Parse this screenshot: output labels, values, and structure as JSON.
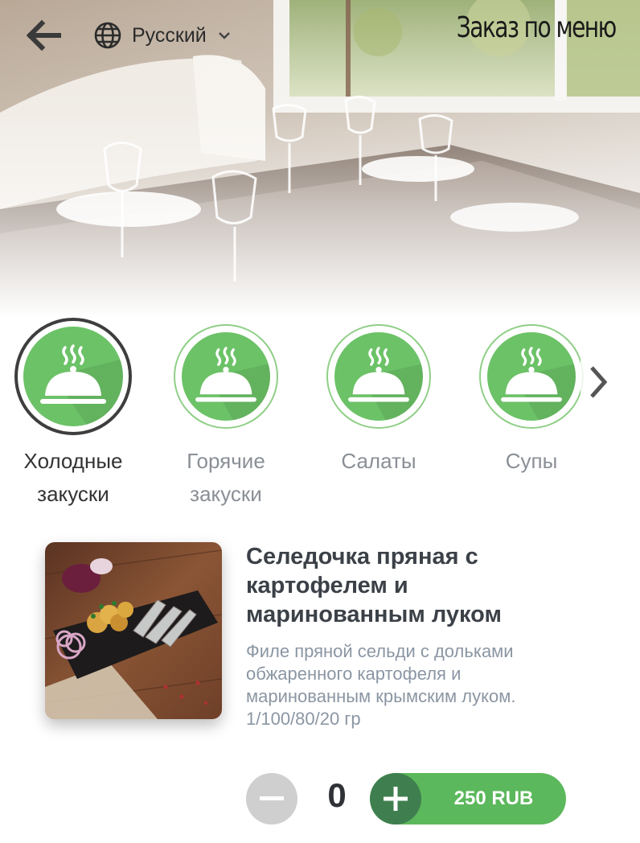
{
  "header": {
    "title": "Заказ по меню",
    "language": "Русский",
    "back_icon": "arrow-left-icon",
    "language_icon": "globe-icon"
  },
  "categories": {
    "items": [
      {
        "line1": "Холодные",
        "line2": "закуски",
        "active": true,
        "icon": "cloche-icon"
      },
      {
        "line1": "Горячие",
        "line2": "закуски",
        "active": false,
        "icon": "cloche-icon"
      },
      {
        "line1": "Салаты",
        "line2": "",
        "active": false,
        "icon": "cloche-icon"
      },
      {
        "line1": "Супы",
        "line2": "",
        "active": false,
        "icon": "cloche-icon"
      }
    ],
    "next_icon": "chevron-right-icon"
  },
  "item": {
    "title": "Селедочка пряная с картофелем и маринованным луком",
    "description": "Филе пряной сельди с дольками обжаренного картофеля и маринованным крымским луком. 1/100/80/20 гр",
    "quantity": "0",
    "price": "250 RUB"
  },
  "colors": {
    "accent_green": "#5cb85c",
    "dark_green": "#3f7f4f",
    "icon_green": "#6cc267"
  }
}
